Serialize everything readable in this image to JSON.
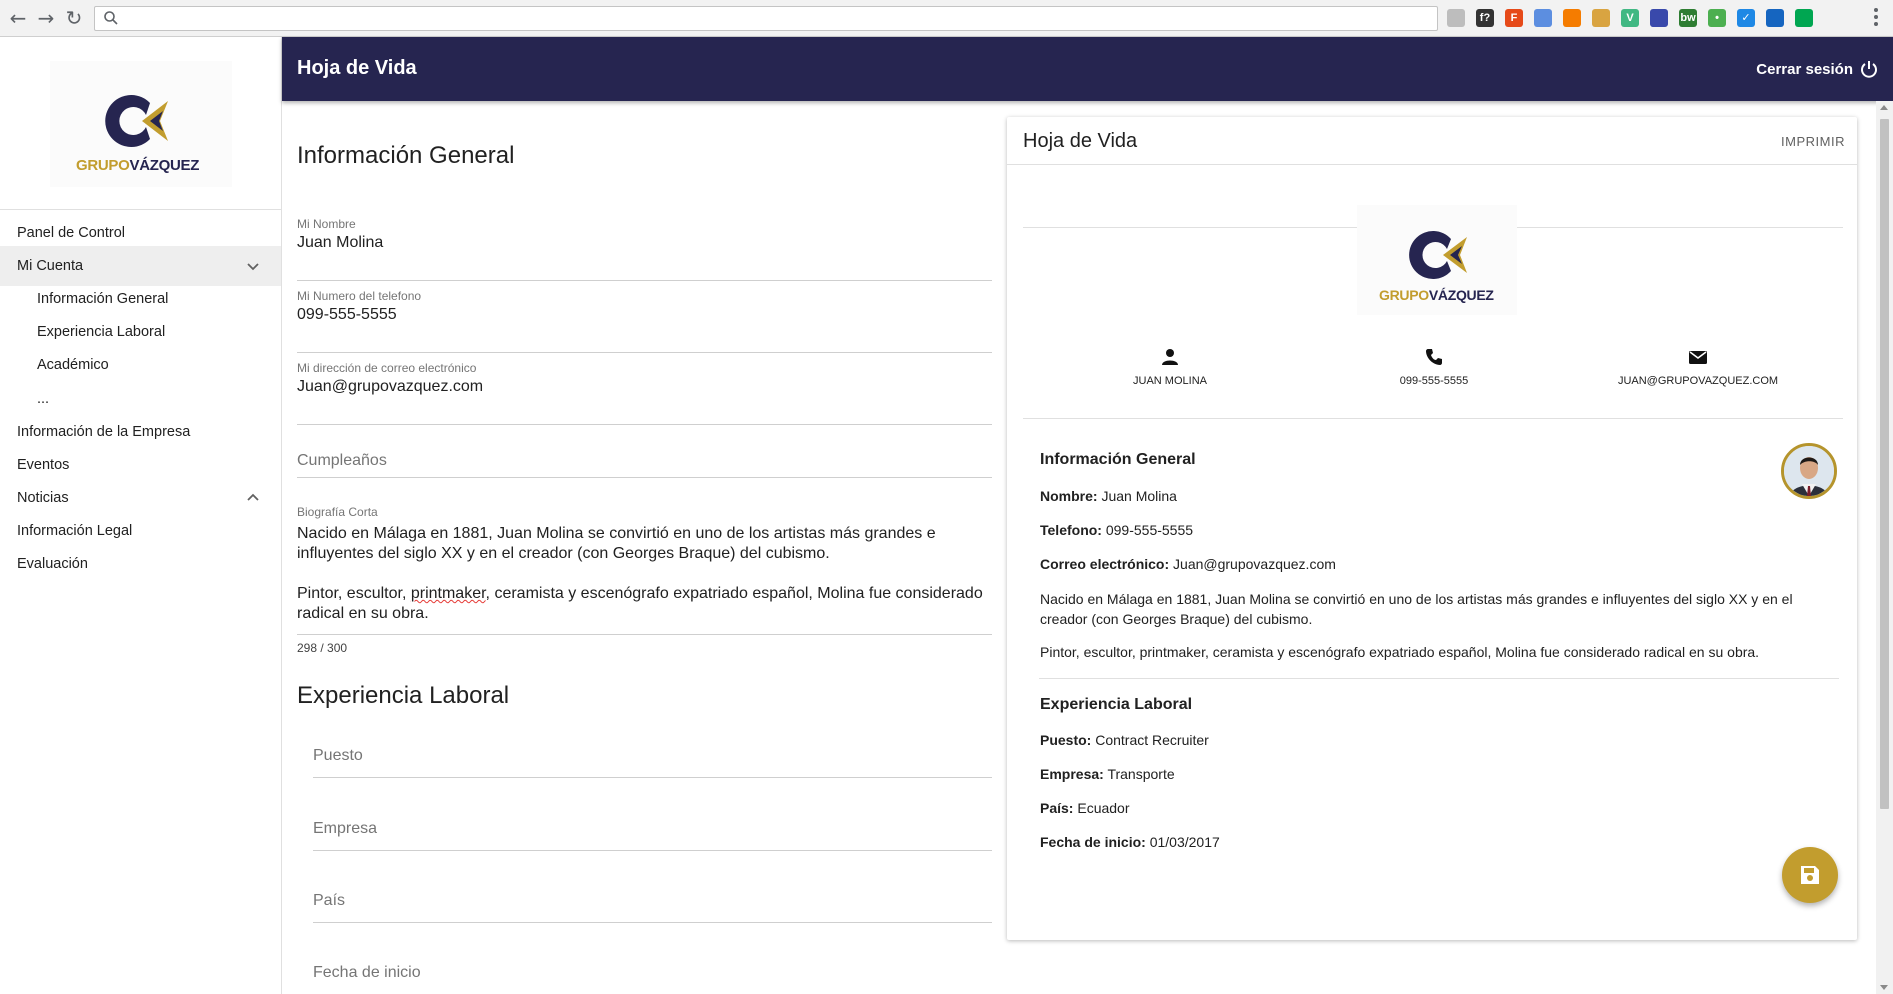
{
  "browser": {
    "back_icon": "arrow-back-icon",
    "forward_icon": "arrow-forward-icon",
    "reload_icon": "reload-icon",
    "address_value": "",
    "extensions": [
      "pdf-icon",
      "f-icon",
      "flow-icon",
      "code-icon",
      "fox-icon",
      "git-icon",
      "v-icon",
      "book-icon",
      "bw-icon",
      "dot-icon",
      "check-icon",
      "shield-icon",
      "green-icon"
    ],
    "extension_colors": [
      "#bdbdbd",
      "#333333",
      "#e64a19",
      "#5c8ee0",
      "#f57c00",
      "#d9a441",
      "#41b883",
      "#3949ab",
      "#2e7d32",
      "#4caf50",
      "#1e88e5",
      "#1565c0",
      "#00a651"
    ],
    "extension_glyphs": [
      "",
      "f?",
      "F",
      "",
      "",
      "",
      "V",
      "",
      "bw",
      "•",
      "✓",
      "",
      ""
    ]
  },
  "brand": {
    "logo_text_gold": "GRUPO",
    "logo_text_navy": "VÁZQUEZ",
    "navy": "#262550",
    "gold": "#c29d2e"
  },
  "sidebar": {
    "items": [
      {
        "label": "Panel de Control"
      },
      {
        "label": "Mi Cuenta"
      },
      {
        "label": "Información General"
      },
      {
        "label": "Experiencia Laboral"
      },
      {
        "label": "Académico"
      },
      {
        "label": "..."
      },
      {
        "label": "Información de la Empresa"
      },
      {
        "label": "Eventos"
      },
      {
        "label": "Noticias"
      },
      {
        "label": "Información Legal"
      },
      {
        "label": "Evaluación"
      }
    ]
  },
  "header": {
    "title": "Hoja de Vida",
    "logout_label": "Cerrar sesión"
  },
  "form": {
    "general_title": "Información General",
    "name": {
      "label": "Mi Nombre",
      "value": "Juan Molina"
    },
    "phone": {
      "label": "Mi Numero del telefono",
      "value": "099-555-5555"
    },
    "email": {
      "label": "Mi dirección de correo electrónico",
      "value": "Juan@grupovazquez.com"
    },
    "birthday": {
      "placeholder": "Cumpleaños"
    },
    "bio": {
      "label": "Biografía Corta",
      "p1": "Nacido en Málaga en 1881, Juan Molina se convirtió en uno de los artistas más grandes e influyentes del siglo XX y en el creador (con Georges Braque) del cubismo.",
      "p2_before": "Pintor, escultor, ",
      "p2_misspelled": "printmaker",
      "p2_after": ", ceramista y escenógrafo expatriado español, Molina fue considerado radical en su obra.",
      "counter": "298 / 300"
    },
    "experience_title": "Experiencia Laboral",
    "position": {
      "placeholder": "Puesto"
    },
    "company": {
      "placeholder": "Empresa"
    },
    "country": {
      "placeholder": "País"
    },
    "start_date": {
      "placeholder": "Fecha de inicio"
    }
  },
  "preview": {
    "title": "Hoja de Vida",
    "print_label": "IMPRIMIR",
    "contact_name": "JUAN MOLINA",
    "contact_phone": "099-555-5555",
    "contact_email": "JUAN@GRUPOVAZQUEZ.COM",
    "general_heading": "Información General",
    "name_label": "Nombre:",
    "name_value": "Juan Molina",
    "phone_label": "Telefono:",
    "phone_value": "099-555-5555",
    "email_label": "Correo electrónico:",
    "email_value": "Juan@grupovazquez.com",
    "bio_p1": "Nacido en Málaga en 1881, Juan Molina se convirtió en uno de los artistas más grandes e influyentes del siglo XX y en el creador (con Georges Braque) del cubismo.",
    "bio_p2": "Pintor, escultor, printmaker, ceramista y escenógrafo expatriado español, Molina fue considerado radical en su obra.",
    "experience_heading": "Experiencia Laboral",
    "position_label": "Puesto:",
    "position_value": "Contract Recruiter",
    "company_label": "Empresa:",
    "company_value": "Transporte",
    "country_label": "País:",
    "country_value": "Ecuador",
    "start_label": "Fecha de inicio:",
    "start_value": "01/03/2017"
  }
}
